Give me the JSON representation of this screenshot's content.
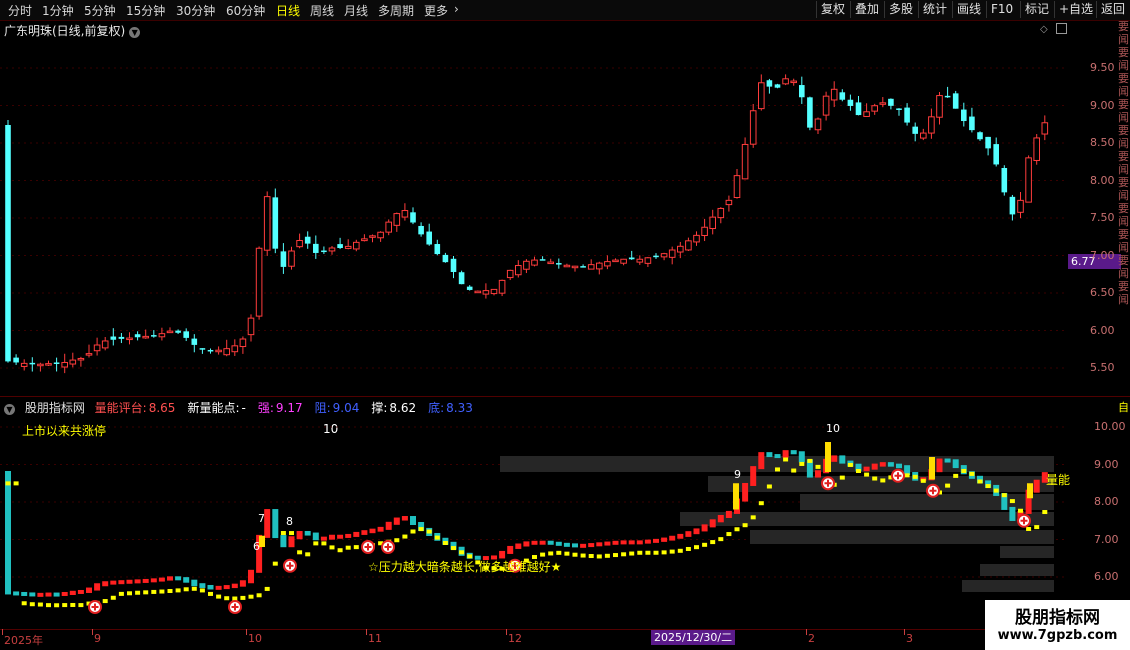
{
  "toolbar": {
    "periods": [
      "分时",
      "1分钟",
      "5分钟",
      "15分钟",
      "30分钟",
      "60分钟",
      "日线",
      "周线",
      "月线",
      "多周期",
      "更多"
    ],
    "active_period": "日线",
    "right_buttons": [
      "复权",
      "叠加",
      "多股",
      "统计",
      "画线",
      "F10",
      "标记",
      "+自选",
      "返回"
    ]
  },
  "main_panel": {
    "title": "广东明珠(日线,前复权)",
    "price_ticks": [
      "9.50",
      "9.00",
      "8.50",
      "8.00",
      "7.50",
      "7.00",
      "6.50",
      "6.00",
      "5.50"
    ],
    "current_price_tag": "6.77"
  },
  "indicator_panel": {
    "name": "股朋指标网",
    "items": [
      {
        "label": "量能评台:",
        "value": "8.65",
        "color": "#ff5050"
      },
      {
        "label": "新量能点:",
        "value": "-",
        "color": "#ffffff"
      },
      {
        "label": "强:",
        "value": "9.17",
        "color": "#ff40ff"
      },
      {
        "label": "阻:",
        "value": "9.04",
        "color": "#4060ff"
      },
      {
        "label": "撑:",
        "value": "8.62",
        "color": "#ffffff"
      },
      {
        "label": "底:",
        "value": "8.33",
        "color": "#4060ff"
      }
    ],
    "limit_up_label": "上市以来共涨停",
    "limit_up_count": "10",
    "note": "☆压力越大暗条越长,做多越难越好★",
    "ticks": [
      "10.00",
      "9.00",
      "8.00",
      "7.00",
      "6.00"
    ],
    "marker_numbers": [
      "6",
      "7",
      "8",
      "9",
      "10"
    ],
    "side_label": "量能"
  },
  "date_axis": {
    "labels": [
      "2025年",
      "9",
      "10",
      "11",
      "12",
      "2",
      "3"
    ],
    "highlight": "2025/12/30/二"
  },
  "watermark": {
    "name": "股朋指标网",
    "url": "www.7gpzb.com"
  },
  "colors": {
    "up": "#ff3c3c",
    "down": "#54ffff",
    "volume_bar": "#ffff00",
    "highlight": "#5a1a8a"
  }
}
